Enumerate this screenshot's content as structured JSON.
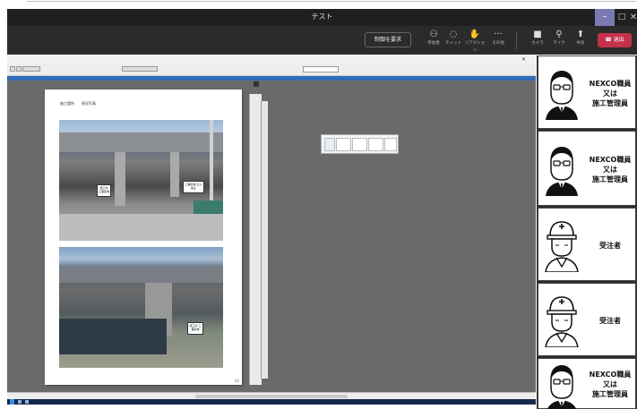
{
  "window": {
    "title": "テスト"
  },
  "toolbar": {
    "request_control_label": "制御を要求",
    "items": [
      {
        "icon": "participants-icon",
        "label": "参加者"
      },
      {
        "icon": "chat-icon",
        "label": "チャット"
      },
      {
        "icon": "reactions-icon",
        "label": "リアクション"
      },
      {
        "icon": "more-icon",
        "label": "その他"
      },
      {
        "icon": "camera-icon",
        "label": "カメラ"
      },
      {
        "icon": "mic-icon",
        "label": "マイク"
      },
      {
        "icon": "share-icon",
        "label": "共有"
      }
    ],
    "leave_label": "退出"
  },
  "document": {
    "sheet_heading": "施工箇所　　現況写真",
    "photo1_sign_left": "施工中 工事区域",
    "photo1_sign_right": "工事区域 立入禁止",
    "photo2_sign": "施工中 工事区域",
    "page_number": "22"
  },
  "participants": [
    {
      "name": "NEXCO職員\n又は\n施工管理員",
      "kind": "glasses"
    },
    {
      "name": "NEXCO職員\n又は\n施工管理員",
      "kind": "glasses"
    },
    {
      "name": "受注者",
      "kind": "helmet"
    },
    {
      "name": "受注者",
      "kind": "helmet"
    },
    {
      "name": "NEXCO職員\n又は\n施工管理員",
      "kind": "glasses"
    }
  ]
}
